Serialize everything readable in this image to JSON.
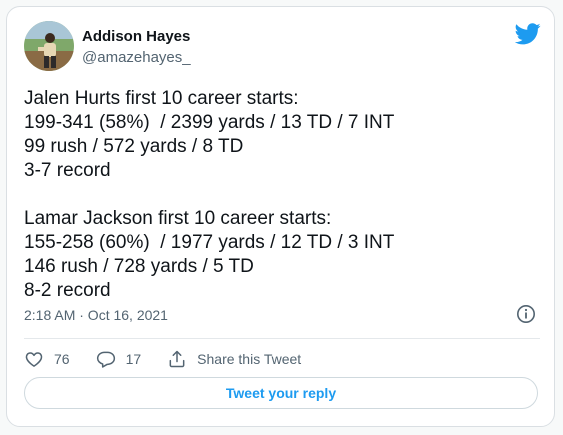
{
  "tweet": {
    "author": {
      "name": "Addison Hayes",
      "handle": "@amazehayes_"
    },
    "text_lines": [
      "Jalen Hurts first 10 career starts:",
      "199-341 (58%)  / 2399 yards / 13 TD / 7 INT",
      "99 rush / 572 yards / 8 TD",
      "3-7 record",
      "",
      "Lamar Jackson first 10 career starts:",
      "155-258 (60%)  / 1977 yards / 12 TD / 3 INT",
      "146 rush / 728 yards / 5 TD",
      "8-2 record"
    ],
    "timestamp": "2:18 AM · Oct 16, 2021",
    "actions": {
      "likes": "76",
      "replies": "17",
      "share_label": "Share this Tweet"
    },
    "reply_button_label": "Tweet your reply"
  },
  "colors": {
    "accent": "#1d9bf0",
    "secondary_text": "#536471",
    "primary_text": "#0f1419",
    "border": "#dadfe3"
  },
  "icons": [
    "twitter-bird-icon",
    "info-icon",
    "heart-icon",
    "reply-bubble-icon",
    "share-icon"
  ]
}
